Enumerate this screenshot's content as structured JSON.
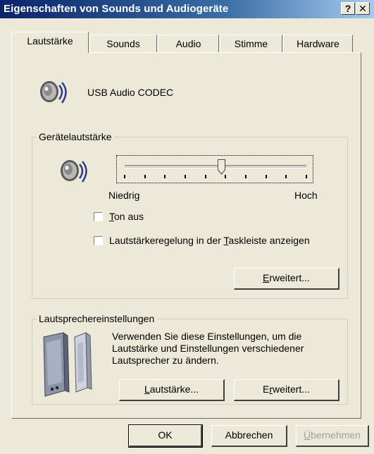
{
  "window": {
    "title": "Eigenschaften von Sounds und Audiogeräte",
    "help_button": "?",
    "close_button": "✕"
  },
  "tabs": [
    {
      "label": "Lautstärke",
      "active": true
    },
    {
      "label": "Sounds",
      "active": false
    },
    {
      "label": "Audio",
      "active": false
    },
    {
      "label": "Stimme",
      "active": false
    },
    {
      "label": "Hardware",
      "active": false
    }
  ],
  "device": {
    "name": "USB Audio CODEC",
    "icon": "speaker-icon"
  },
  "device_volume": {
    "group_title": "Gerätelautstärke",
    "slider": {
      "min_label": "Niedrig",
      "max_label": "Hoch",
      "level": 0.53,
      "tick_count": 10
    },
    "mute": {
      "prefix": "",
      "mnemonic": "T",
      "suffix": "on aus",
      "checked": false
    },
    "taskbar": {
      "prefix": "Lautstärkeregelung in der ",
      "mnemonic": "T",
      "suffix": "askleiste anzeigen",
      "checked": false
    },
    "advanced_button": {
      "mnemonic": "E",
      "rest": "rweitert..."
    }
  },
  "speaker_settings": {
    "group_title": "Lautsprechereinstellungen",
    "description": "Verwenden Sie diese Einstellungen, um die Lautstärke und Einstellungen verschiedener Lautsprecher zu ändern.",
    "volume_button": {
      "mnemonic": "L",
      "rest": "autstärke..."
    },
    "advanced_button": {
      "prefix": "E",
      "mnemonic": "r",
      "rest": "weitert..."
    }
  },
  "footer": {
    "ok_label": "OK",
    "cancel_label": "Abbrechen",
    "apply_button": {
      "mnemonic": "Ü",
      "rest": "bernehmen",
      "disabled": true
    }
  },
  "colors": {
    "dialog_bg": "#ECE9D8",
    "title_gradient_start": "#0A246A",
    "title_gradient_end": "#A6CAF0"
  }
}
